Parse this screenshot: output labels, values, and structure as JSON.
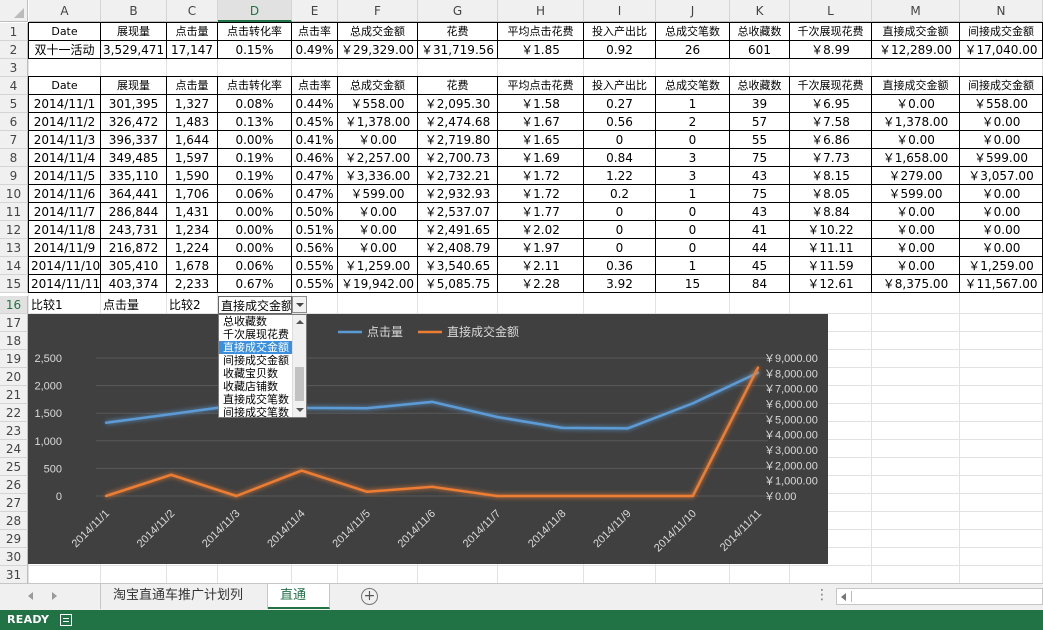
{
  "columns": [
    "A",
    "B",
    "C",
    "D",
    "E",
    "F",
    "G",
    "H",
    "I",
    "J",
    "K",
    "L",
    "M",
    "N"
  ],
  "rows": [
    "1",
    "2",
    "3",
    "4",
    "5",
    "6",
    "7",
    "8",
    "9",
    "10",
    "11",
    "12",
    "13",
    "14",
    "15",
    "16",
    "17",
    "18",
    "19",
    "20",
    "21",
    "22",
    "23",
    "24",
    "25",
    "26",
    "27",
    "28",
    "29",
    "30",
    "31"
  ],
  "summary": {
    "headers": [
      "Date",
      "展现量",
      "点击量",
      "点击转化率",
      "点击率",
      "总成交金额",
      "花费",
      "平均点击花费",
      "投入产出比",
      "总成交笔数",
      "总收藏数",
      "千次展现花费",
      "直接成交金额",
      "间接成交金额"
    ],
    "row": [
      "双十一活动",
      "3,529,471",
      "17,147",
      "0.15%",
      "0.49%",
      "￥29,329.00",
      "￥31,719.56",
      "￥1.85",
      "0.92",
      "26",
      "601",
      "￥8.99",
      "￥12,289.00",
      "￥17,040.00"
    ]
  },
  "daily": {
    "headers": [
      "Date",
      "展现量",
      "点击量",
      "点击转化率",
      "点击率",
      "总成交金额",
      "花费",
      "平均点击花费",
      "投入产出比",
      "总成交笔数",
      "总收藏数",
      "千次展现花费",
      "直接成交金额",
      "间接成交金额"
    ],
    "rows": [
      [
        "2014/11/1",
        "301,395",
        "1,327",
        "0.08%",
        "0.44%",
        "￥558.00",
        "￥2,095.30",
        "￥1.58",
        "0.27",
        "1",
        "39",
        "￥6.95",
        "￥0.00",
        "￥558.00"
      ],
      [
        "2014/11/2",
        "326,472",
        "1,483",
        "0.13%",
        "0.45%",
        "￥1,378.00",
        "￥2,474.68",
        "￥1.67",
        "0.56",
        "2",
        "57",
        "￥7.58",
        "￥1,378.00",
        "￥0.00"
      ],
      [
        "2014/11/3",
        "396,337",
        "1,644",
        "0.00%",
        "0.41%",
        "￥0.00",
        "￥2,719.80",
        "￥1.65",
        "0",
        "0",
        "55",
        "￥6.86",
        "￥0.00",
        "￥0.00"
      ],
      [
        "2014/11/4",
        "349,485",
        "1,597",
        "0.19%",
        "0.46%",
        "￥2,257.00",
        "￥2,700.73",
        "￥1.69",
        "0.84",
        "3",
        "75",
        "￥7.73",
        "￥1,658.00",
        "￥599.00"
      ],
      [
        "2014/11/5",
        "335,110",
        "1,590",
        "0.19%",
        "0.47%",
        "￥3,336.00",
        "￥2,732.21",
        "￥1.72",
        "1.22",
        "3",
        "43",
        "￥8.15",
        "￥279.00",
        "￥3,057.00"
      ],
      [
        "2014/11/6",
        "364,441",
        "1,706",
        "0.06%",
        "0.47%",
        "￥599.00",
        "￥2,932.93",
        "￥1.72",
        "0.2",
        "1",
        "75",
        "￥8.05",
        "￥599.00",
        "￥0.00"
      ],
      [
        "2014/11/7",
        "286,844",
        "1,431",
        "0.00%",
        "0.50%",
        "￥0.00",
        "￥2,537.07",
        "￥1.77",
        "0",
        "0",
        "43",
        "￥8.84",
        "￥0.00",
        "￥0.00"
      ],
      [
        "2014/11/8",
        "243,731",
        "1,234",
        "0.00%",
        "0.51%",
        "￥0.00",
        "￥2,491.65",
        "￥2.02",
        "0",
        "0",
        "41",
        "￥10.22",
        "￥0.00",
        "￥0.00"
      ],
      [
        "2014/11/9",
        "216,872",
        "1,224",
        "0.00%",
        "0.56%",
        "￥0.00",
        "￥2,408.79",
        "￥1.97",
        "0",
        "0",
        "44",
        "￥11.11",
        "￥0.00",
        "￥0.00"
      ],
      [
        "2014/11/10",
        "305,410",
        "1,678",
        "0.06%",
        "0.55%",
        "￥1,259.00",
        "￥3,540.65",
        "￥2.11",
        "0.36",
        "1",
        "45",
        "￥11.59",
        "￥0.00",
        "￥1,259.00"
      ],
      [
        "2014/11/11",
        "403,374",
        "2,233",
        "0.67%",
        "0.55%",
        "￥19,942.00",
        "￥5,085.75",
        "￥2.28",
        "3.92",
        "15",
        "84",
        "￥12.61",
        "￥8,375.00",
        "￥11,567.00"
      ]
    ]
  },
  "compare_row": {
    "label1": "比较1",
    "value1": "点击量",
    "label2": "比较2",
    "value2": "直接成交金额"
  },
  "dropdown": {
    "options": [
      "总收藏数",
      "千次展现花费",
      "直接成交金额",
      "间接成交金额",
      "收藏宝贝数",
      "收藏店铺数",
      "直接成交笔数",
      "间接成交笔数"
    ],
    "selected_index": 2
  },
  "chart_data": {
    "type": "line",
    "categories": [
      "2014/11/1",
      "2014/11/2",
      "2014/11/3",
      "2014/11/4",
      "2014/11/5",
      "2014/11/6",
      "2014/11/7",
      "2014/11/8",
      "2014/11/9",
      "2014/11/10",
      "2014/11/11"
    ],
    "series": [
      {
        "name": "点击量",
        "axis": "left",
        "color": "#5b9bd5",
        "values": [
          1327,
          1483,
          1644,
          1597,
          1590,
          1706,
          1431,
          1234,
          1224,
          1678,
          2233
        ]
      },
      {
        "name": "直接成交金额",
        "axis": "right",
        "color": "#ed7d31",
        "values": [
          0,
          1378,
          0,
          1658,
          279,
          599,
          0,
          0,
          0,
          0,
          8375
        ]
      }
    ],
    "left_axis": {
      "min": 0,
      "max": 2500,
      "ticks": [
        0,
        500,
        1000,
        1500,
        2000,
        2500
      ],
      "tick_labels": [
        "0",
        "500",
        "1,000",
        "1,500",
        "2,000",
        "2,500"
      ]
    },
    "right_axis": {
      "min": 0,
      "max": 9000,
      "ticks": [
        0,
        1000,
        2000,
        3000,
        4000,
        5000,
        6000,
        7000,
        8000,
        9000
      ],
      "tick_labels": [
        "￥0.00",
        "￥1,000.00",
        "￥2,000.00",
        "￥3,000.00",
        "￥4,000.00",
        "￥5,000.00",
        "￥6,000.00",
        "￥7,000.00",
        "￥8,000.00",
        "￥9,000.00"
      ]
    },
    "legend_position": "top",
    "gridlines": true,
    "background": "#404040"
  },
  "sheet_tabs": [
    "淘宝直通车推广计划列表",
    "直通车"
  ],
  "active_tab_index": 1,
  "add_sheet_label": "⊕",
  "status": {
    "text": "READY"
  }
}
